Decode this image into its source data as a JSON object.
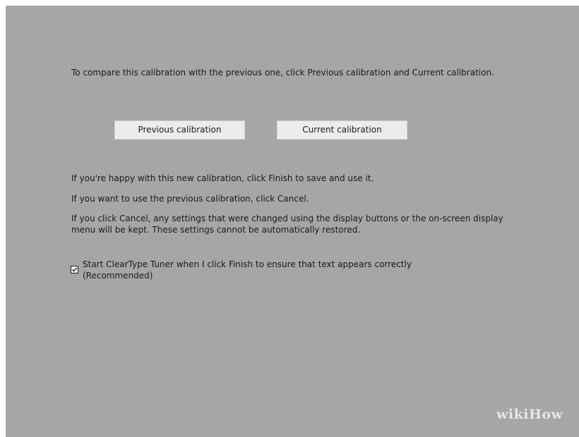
{
  "dialog": {
    "intro_text": "To compare this calibration with the previous one, click Previous calibration and Current calibration.",
    "buttons": {
      "previous_label": "Previous calibration",
      "current_label": "Current calibration"
    },
    "paragraphs": [
      "If you're happy with this new calibration, click Finish to save and use it.",
      "If you want to use the previous calibration, click Cancel.",
      "If you click Cancel, any settings that were changed using the display buttons or the on-screen display menu will be kept. These settings cannot be automatically restored."
    ],
    "cleartype_checkbox": {
      "label": "Start ClearType Tuner when I click Finish to ensure that text appears correctly (Recommended)",
      "checked": true
    }
  },
  "watermark": "wikiHow"
}
